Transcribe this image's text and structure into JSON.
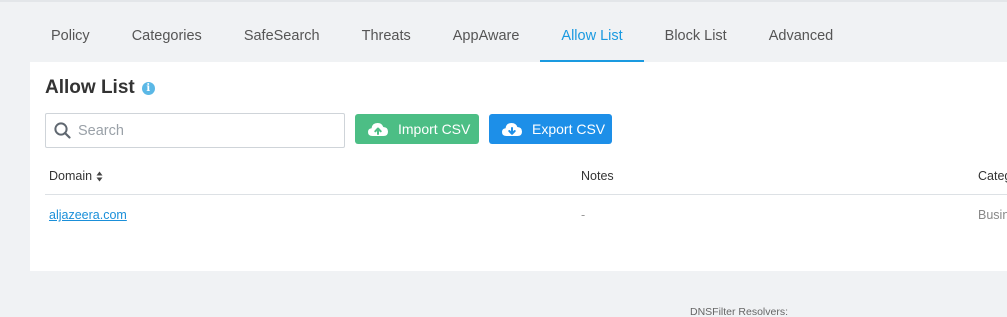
{
  "tabs": [
    {
      "label": "Policy"
    },
    {
      "label": "Categories"
    },
    {
      "label": "SafeSearch"
    },
    {
      "label": "Threats"
    },
    {
      "label": "AppAware"
    },
    {
      "label": "Allow List",
      "active": true
    },
    {
      "label": "Block List"
    },
    {
      "label": "Advanced"
    }
  ],
  "panel": {
    "title": "Allow List",
    "info_icon": "info-circle",
    "search": {
      "placeholder": "Search",
      "value": ""
    },
    "import_button": {
      "label": "Import CSV",
      "icon": "cloud-upload"
    },
    "export_button": {
      "label": "Export CSV",
      "icon": "cloud-download"
    }
  },
  "table": {
    "columns": [
      {
        "label": "Domain",
        "sortable": true
      },
      {
        "label": "Notes"
      },
      {
        "label": "Categ"
      }
    ],
    "rows": [
      {
        "domain": "aljazeera.com",
        "notes": "-",
        "category": "Busin"
      }
    ]
  },
  "footer": {
    "text": "DNSFilter Resolvers:"
  },
  "colors": {
    "accent": "#1a9ae0",
    "import_button": "#4cbe85",
    "export_button": "#1d8fe8",
    "background": "#f0f2f4"
  }
}
